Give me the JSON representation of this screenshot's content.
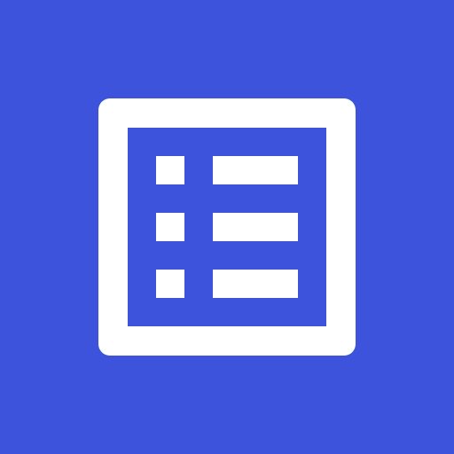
{
  "app_icon": {
    "icon_name": "list-icon",
    "colors": {
      "background": "#3D53DB",
      "glyph": "#FFFFFF"
    }
  }
}
